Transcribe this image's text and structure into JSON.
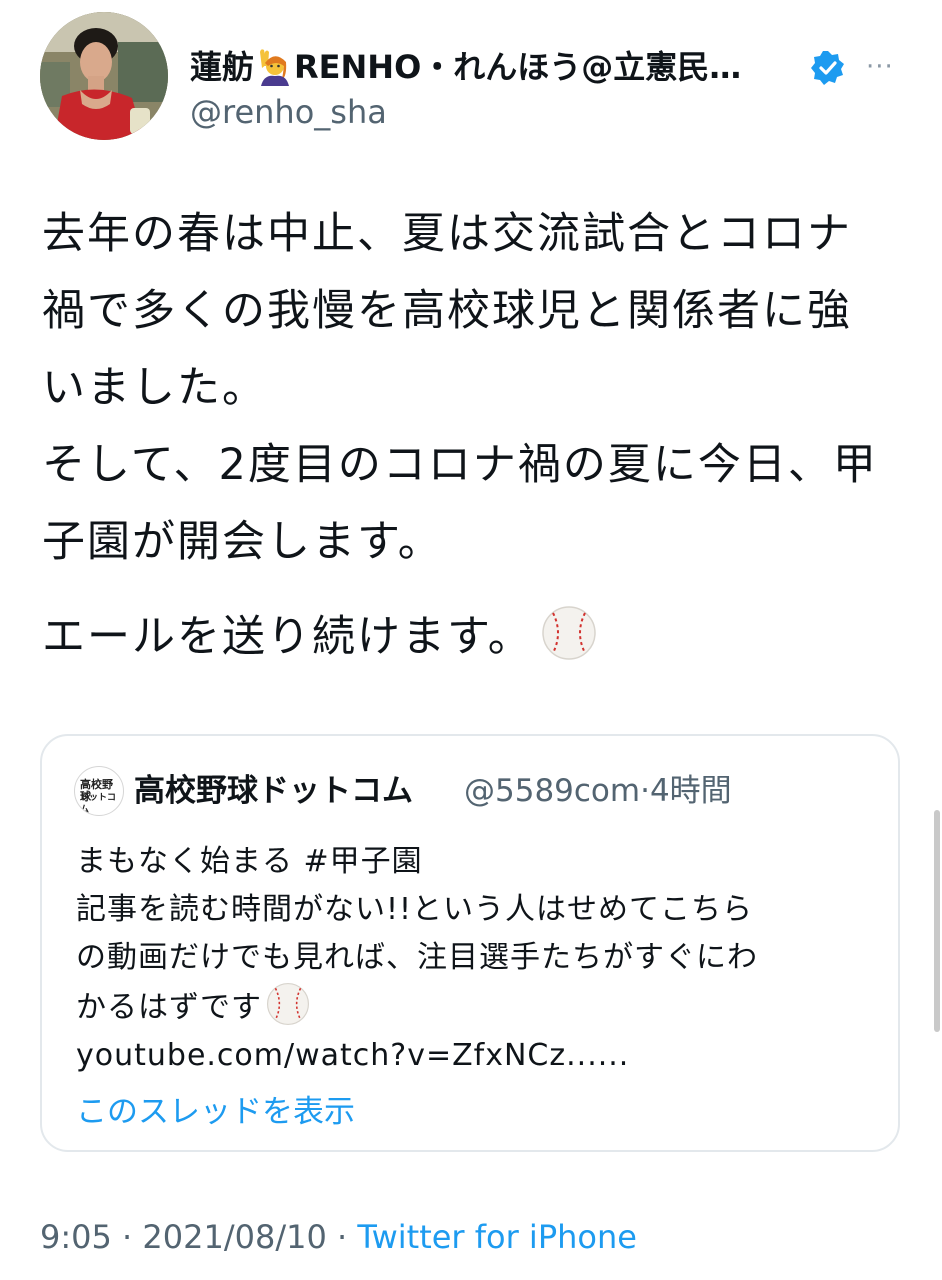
{
  "author": {
    "display_name": "蓮舫",
    "display_name_rest": "RENHO・れんほう@立憲民…",
    "handle": "@renho_sha",
    "more_icon": "···"
  },
  "tweet": {
    "paragraph1": "去年の春は中止、夏は交流試合とコロナ禍で多くの我慢を高校球児と関係者に強いました。\nそして、2度目のコロナ禍の夏に今日、甲子園が開会します。",
    "paragraph2": "エールを送り続けます。"
  },
  "quote": {
    "avatar_lines": [
      "高校野球",
      "ドットコム"
    ],
    "name": "高校野球ドットコム",
    "handle": "@5589com",
    "time": "·4時間",
    "lines": [
      "まもなく始まる #甲子園",
      "記事を読む時間がない!!という人はせめてこちら",
      "の動画だけでも見れば、注目選手たちがすぐにわ",
      "かるはずです",
      "youtube.com/watch?v=ZfxNCz......"
    ],
    "show_thread": "このスレッドを表示"
  },
  "footer": {
    "time": "9:05",
    "date": "2021/08/10",
    "sep": " · ",
    "source": "Twitter for iPhone"
  },
  "colors": {
    "link": "#1d9bf0",
    "secondary": "#536471",
    "verified": "#1d9bf0"
  },
  "icons": [
    "raising-hand-emoji",
    "verified-badge-icon",
    "more-icon",
    "baseball-emoji"
  ]
}
